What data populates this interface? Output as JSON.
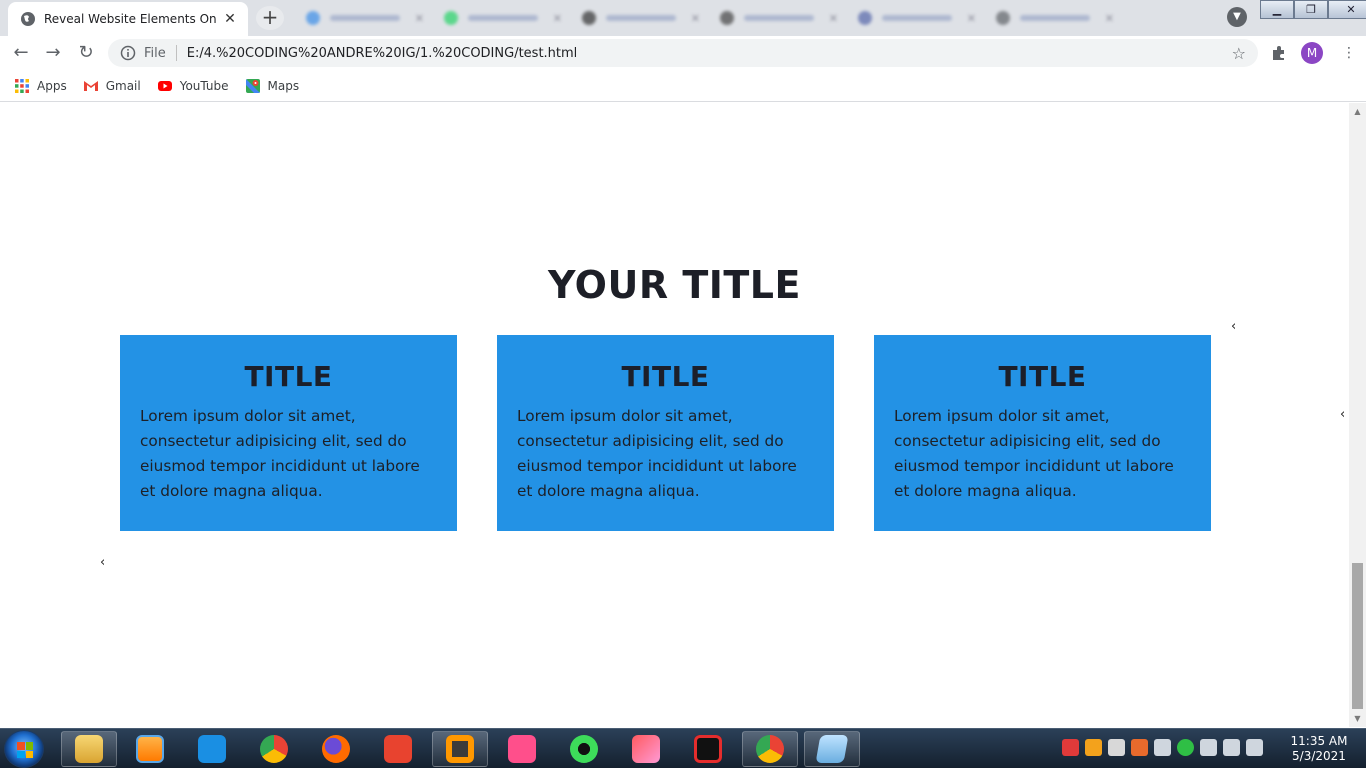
{
  "browser": {
    "active_tab_title": "Reveal Website Elements On Scroll",
    "tab_close_glyph": "✕",
    "new_tab_glyph": "+",
    "url_scheme_label": "File",
    "url": "E:/4.%20CODING%20ANDRE%20IG/1.%20CODING/test.html",
    "profile_initial": "M",
    "bookmarks": [
      {
        "label": "Apps",
        "icon": "apps-grid-icon"
      },
      {
        "label": "Gmail",
        "icon": "gmail-icon"
      },
      {
        "label": "YouTube",
        "icon": "youtube-icon"
      },
      {
        "label": "Maps",
        "icon": "maps-icon"
      }
    ],
    "colors": {
      "tabstrip": "#dee1e6",
      "omnibox": "#f1f3f4",
      "profile": "#8b46c4"
    }
  },
  "page": {
    "heading": "YOUR TITLE",
    "cards": [
      {
        "title": "TITLE",
        "text": "Lorem ipsum dolor sit amet, consectetur adipisicing elit, sed do eiusmod tempor incididunt ut labore et dolore magna aliqua."
      },
      {
        "title": "TITLE",
        "text": "Lorem ipsum dolor sit amet, consectetur adipisicing elit, sed do eiusmod tempor incididunt ut labore et dolore magna aliqua."
      },
      {
        "title": "TITLE",
        "text": "Lorem ipsum dolor sit amet, consectetur adipisicing elit, sed do eiusmod tempor incididunt ut labore et dolore magna aliqua."
      }
    ],
    "caret_glyph": "‹",
    "colors": {
      "card": "#2392e5",
      "heading": "#1d1f27"
    }
  },
  "taskbar": {
    "clock_time": "11:35 AM",
    "clock_date": "5/3/2021"
  }
}
